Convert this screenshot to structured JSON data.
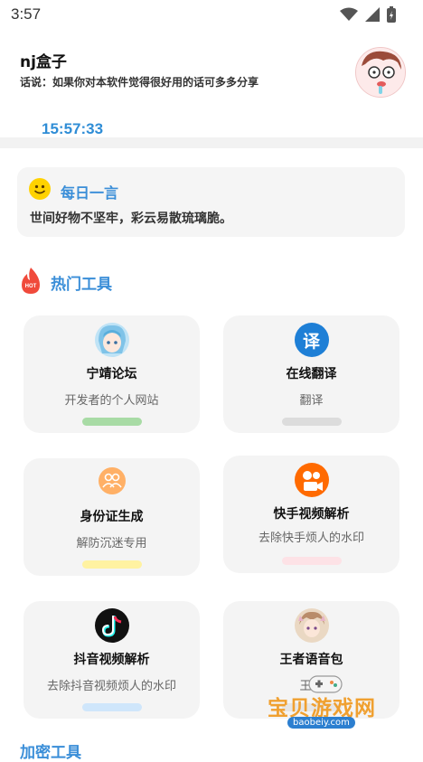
{
  "status_bar": {
    "time": "3:57"
  },
  "header": {
    "app_name": "nj盒子",
    "tagline": "话说：如果你对本软件觉得很好用的话可多多分享",
    "clock": "15:57:33"
  },
  "daily_quote": {
    "title": "每日一言",
    "text": "世间好物不坚牢，彩云易散琉璃脆。"
  },
  "sections": {
    "hot_tools_title": "热门工具",
    "hot_badge": "HOT",
    "more_tools_title": "加密工具"
  },
  "tools": [
    {
      "name": "宁靖论坛",
      "desc": "开发者的个人网站",
      "icon": "anime-girl-avatar-icon",
      "bar_color": "#a8dba5",
      "icon_color": "#9fd0ef"
    },
    {
      "name": "在线翻译",
      "desc": "翻译",
      "icon": "translate-icon",
      "icon_glyph": "译",
      "bar_color": "#dcdcdc",
      "icon_color": "#1e7fd6"
    },
    {
      "name": "身份证生成",
      "desc": "解防沉迷专用",
      "icon": "people-icon",
      "bar_color": "#fff2a1",
      "icon_color": "#ff9a3c"
    },
    {
      "name": "快手视频解析",
      "desc": "去除快手烦人的水印",
      "icon": "kuaishou-icon",
      "bar_color": "#fde2e6",
      "icon_color": "#ff6a00"
    },
    {
      "name": "抖音视频解析",
      "desc": "去除抖音视频烦人的水印",
      "icon": "tiktok-icon",
      "bar_color": "#cfe6fb",
      "icon_color": "#111111"
    },
    {
      "name": "王者语音包",
      "desc": "王者",
      "icon": "game-character-avatar-icon",
      "bar_color": "#e6e6e6",
      "icon_color": "#d9c3a6"
    }
  ],
  "watermark": {
    "text": "宝贝游戏网",
    "url": "baobeiy.com"
  }
}
